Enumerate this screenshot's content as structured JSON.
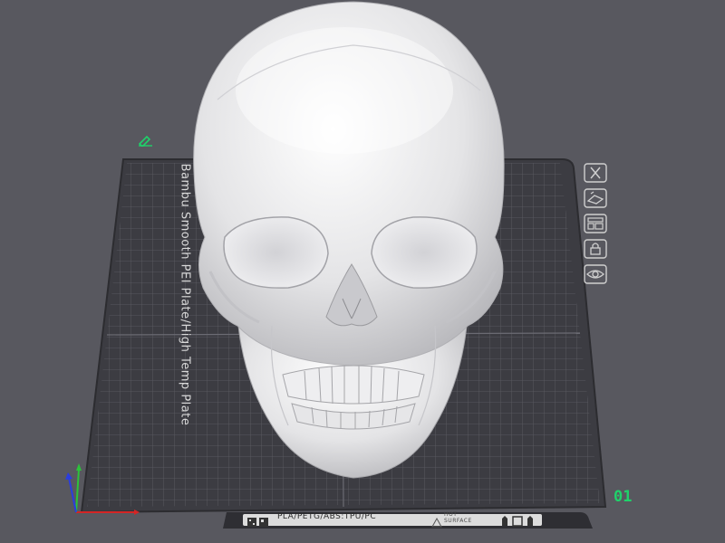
{
  "plate": {
    "name_label": "Bambu Smooth PEI Plate/High Temp Plate",
    "number": "01",
    "materials": "PLA/PETG/ABS:TPU/PC",
    "hot_surface": "HOT SURFACE",
    "accent_color": "#1fd26a"
  },
  "toolbar": {
    "icons": [
      "close-icon",
      "auto-orient-icon",
      "arrange-icon",
      "lock-icon",
      "plate-settings-icon"
    ]
  },
  "model": {
    "name": "skull"
  }
}
